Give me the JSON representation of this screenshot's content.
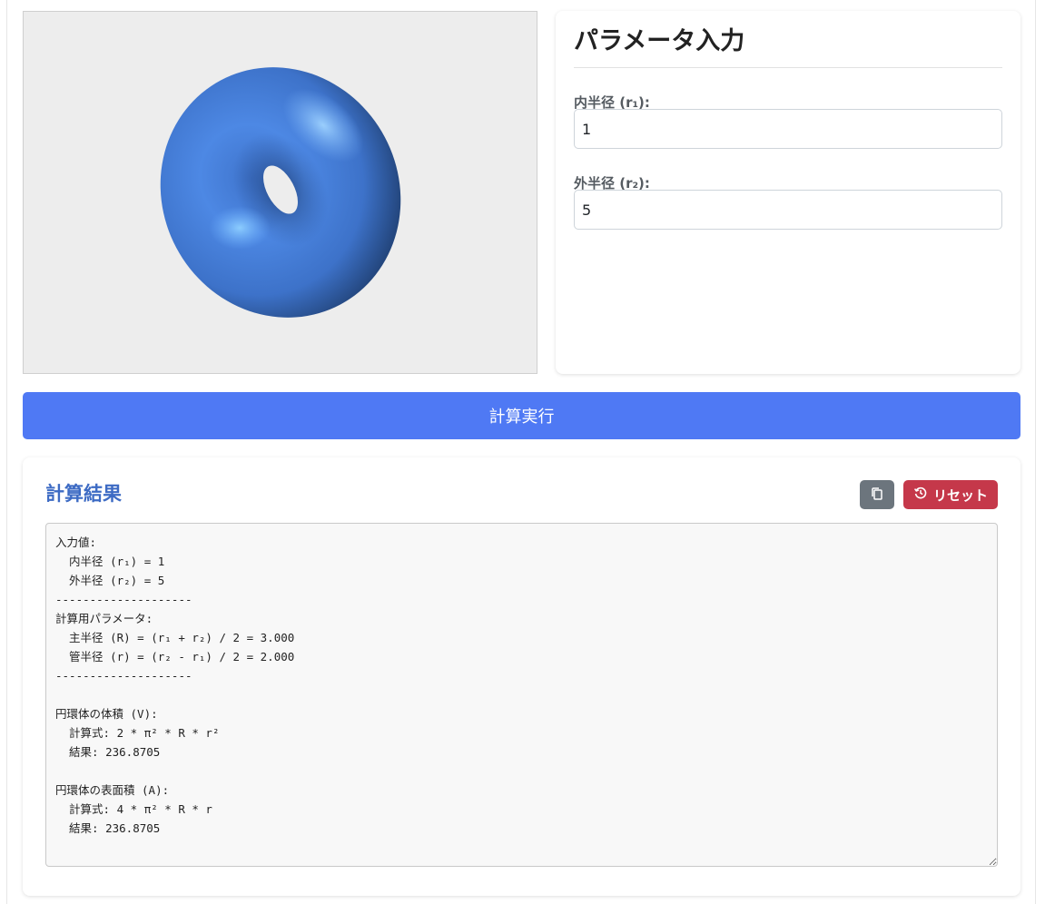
{
  "params": {
    "title": "パラメータ入力",
    "inner_label": "内半径 (r₁):",
    "inner_value": "1",
    "outer_label": "外半径 (r₂):",
    "outer_value": "5"
  },
  "actions": {
    "calculate_label": "計算実行",
    "reset_label": "リセット",
    "copy_icon": "copy-icon",
    "reset_icon": "history-icon"
  },
  "results": {
    "title": "計算結果",
    "output": "入力値:\n  内半径 (r₁) = 1\n  外半径 (r₂) = 5\n--------------------\n計算用パラメータ:\n  主半径 (R) = (r₁ + r₂) / 2 = 3.000\n  管半径 (r) = (r₂ - r₁) / 2 = 2.000\n--------------------\n\n円環体の体積 (V):\n  計算式: 2 * π² * R * r²\n  結果: 236.8705\n\n円環体の表面積 (A):\n  計算式: 4 * π² * R * r\n  結果: 236.8705"
  },
  "colors": {
    "primary_button": "#4f79f4",
    "reset_button": "#c5384a",
    "copy_button": "#6c757d",
    "result_title": "#3d6bc4",
    "torus": "#4a86e8",
    "viewer_background": "#ededed"
  }
}
